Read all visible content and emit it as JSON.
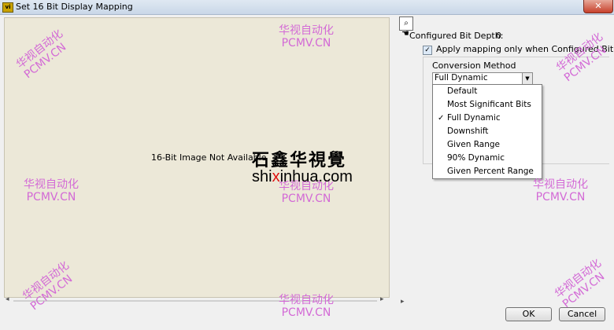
{
  "window": {
    "title": "Set 16 Bit Display Mapping",
    "close_glyph": "✕"
  },
  "preview": {
    "status_text": "16-Bit Image Not Available"
  },
  "settings": {
    "bit_depth_label": "Configured Bit Depth:",
    "bit_depth_value": "0",
    "apply_label": "Apply mapping only when Configured Bit Depth",
    "apply_checked": true,
    "method_label": "Conversion Method",
    "method_selected": "Full Dynamic",
    "method_options": [
      {
        "label": "Default",
        "checked": false
      },
      {
        "label": "Most Significant Bits",
        "checked": false
      },
      {
        "label": "Full Dynamic",
        "checked": true
      },
      {
        "label": "Downshift",
        "checked": false
      },
      {
        "label": "Given Range",
        "checked": false
      },
      {
        "label": "90% Dynamic",
        "checked": false
      },
      {
        "label": "Given Percent Range",
        "checked": false
      }
    ]
  },
  "buttons": {
    "ok": "OK",
    "cancel": "Cancel"
  },
  "watermark": {
    "line1": "华视自动化",
    "line2": "PCMV.CN",
    "color": "#d36ad6"
  },
  "logo": {
    "calligraphy": "石鑫华視覺",
    "url": "shixinhua.com",
    "url_red_part": "x"
  }
}
